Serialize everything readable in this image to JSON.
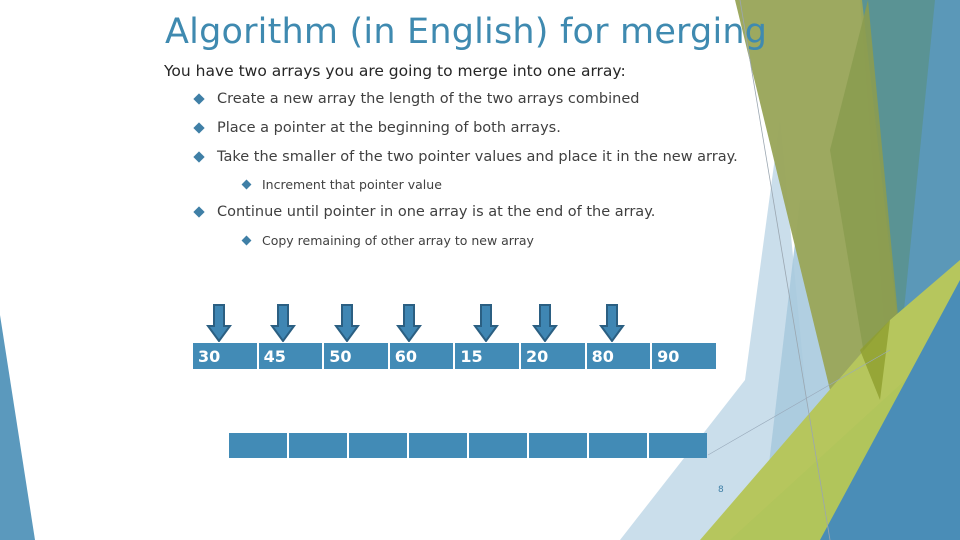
{
  "slide": {
    "title": "Algorithm (in English) for merging",
    "subtitle": "You have two arrays you are going to merge into one array:",
    "bullets": [
      {
        "level": 1,
        "text": "Create a new array the length of the two arrays combined"
      },
      {
        "level": 1,
        "text": "Place a pointer at the beginning of both arrays."
      },
      {
        "level": 1,
        "text": "Take the smaller of the  two pointer values and place it in the new array."
      },
      {
        "level": 2,
        "text": "Increment that pointer value"
      },
      {
        "level": 1,
        "text": "Continue until pointer in one array is at the end of the array."
      },
      {
        "level": 2,
        "text": "Copy remaining of other array to new array"
      }
    ],
    "input_array": [
      "30",
      "45",
      "50",
      "60",
      "15",
      "20",
      "80",
      "90"
    ],
    "pointer_icon": "down-arrow-icon",
    "pointers_over_indices": [
      0,
      1,
      2,
      3,
      4,
      5,
      6
    ],
    "output_array": [
      "",
      "",
      "",
      "",
      "",
      "",
      "",
      ""
    ],
    "slide_number": "8",
    "colors": {
      "title": "#3f8ab0",
      "cell": "#428bb6",
      "arrow_fill": "#3f86b3",
      "arrow_stroke": "#2b5f82",
      "accent_green": "#b5c95b",
      "accent_olive": "#8fa052",
      "accent_blue": "#4a8fb8"
    }
  }
}
